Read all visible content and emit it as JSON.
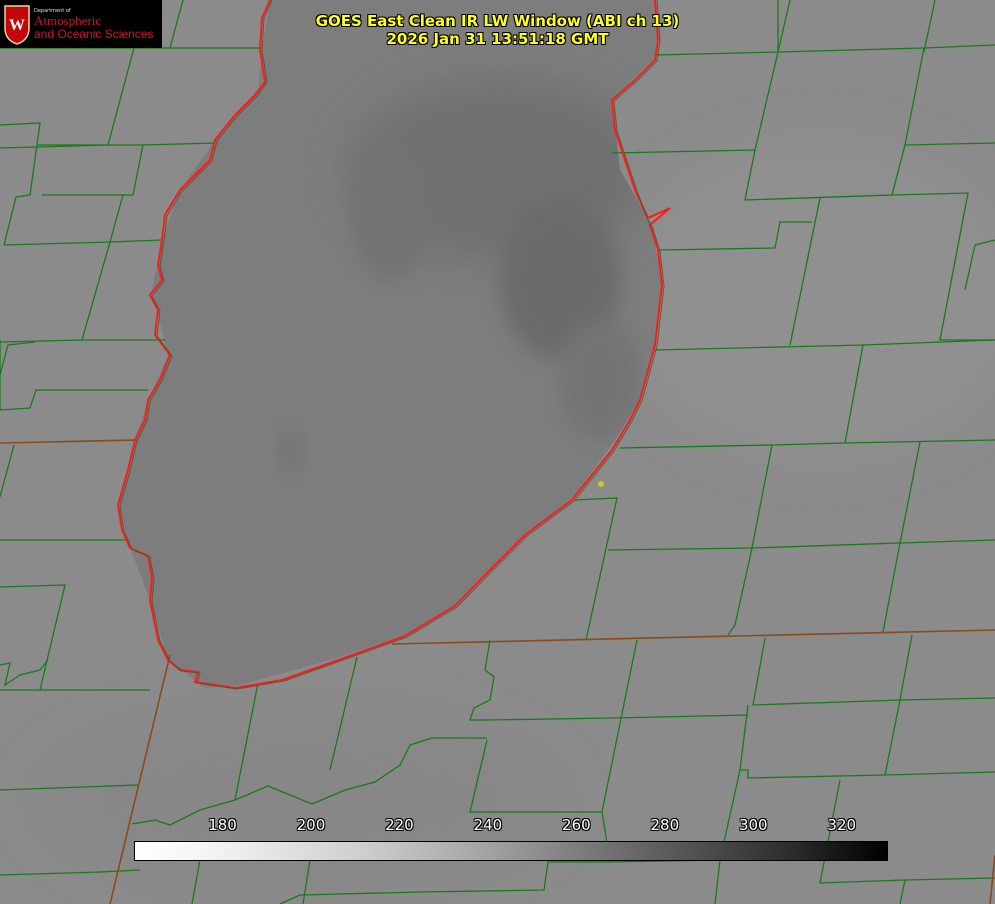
{
  "title": {
    "line1": "GOES East Clean IR LW Window (ABI ch 13)",
    "line2": "2026 Jan 31 13:51:18 GMT"
  },
  "logo": {
    "department": "Department of",
    "line1": "Atmospheric",
    "line2": "and Oceanic Sciences",
    "crest_letter": "W"
  },
  "colorbar": {
    "unit_range": [
      160,
      330
    ],
    "ticks": [
      "180",
      "200",
      "220",
      "240",
      "260",
      "280",
      "300",
      "320"
    ]
  },
  "colors": {
    "background": "#8a8a8a",
    "lake": "#7a7a7a",
    "county_lines": "#1a7a1a",
    "shoreline": "#ff1a1a",
    "title_text": "#ffff20"
  }
}
